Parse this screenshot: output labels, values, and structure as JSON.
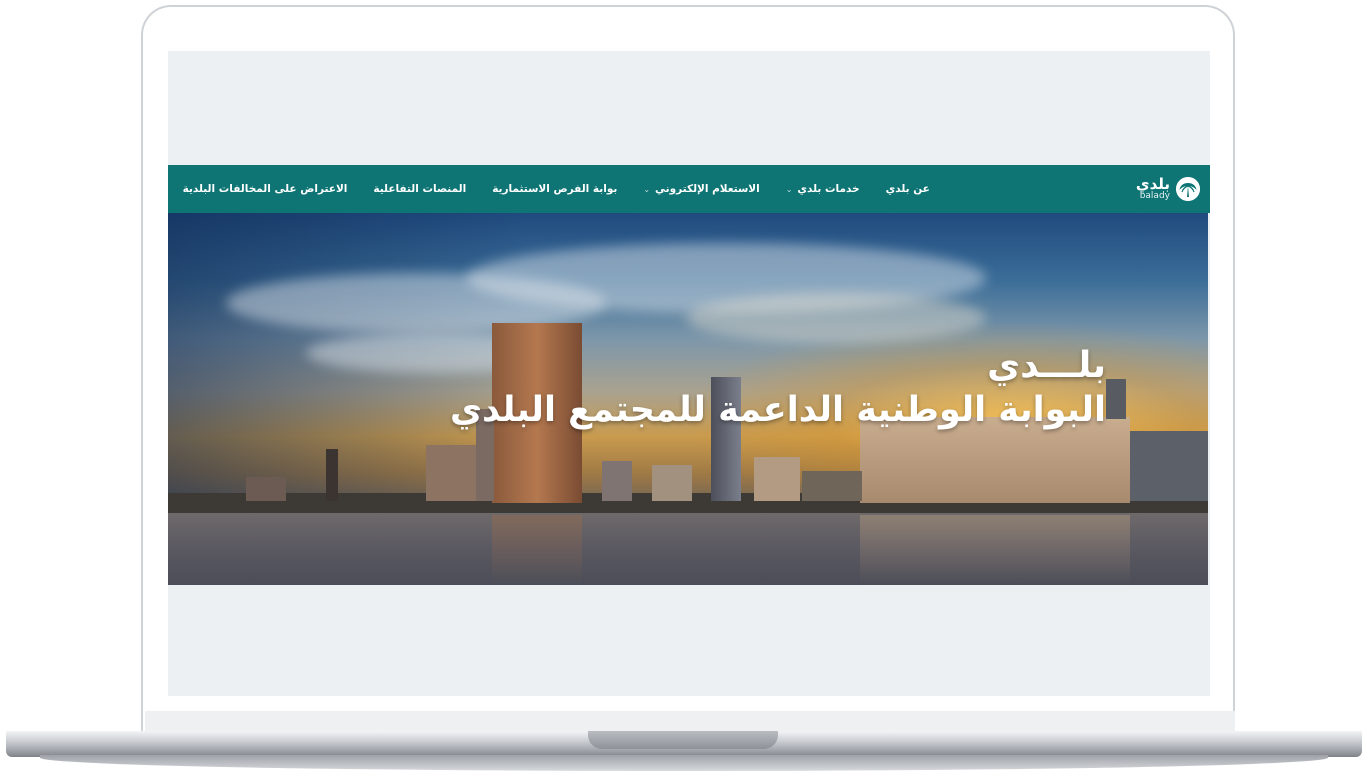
{
  "navbar": {
    "logo": {
      "ar": "بلدي",
      "en": "balady",
      "icon": "palm-emblem-icon"
    },
    "items": [
      {
        "label": "عن بلدي",
        "has_dropdown": false
      },
      {
        "label": "خدمات بلدي",
        "has_dropdown": true
      },
      {
        "label": "الاستعلام الإلكتروني",
        "has_dropdown": true
      },
      {
        "label": "بوابة الفرص الاستثمارية",
        "has_dropdown": false
      },
      {
        "label": "المنصات التفاعلية",
        "has_dropdown": false
      },
      {
        "label": "الاعتراض على المخالفات البلدية",
        "has_dropdown": false
      }
    ]
  },
  "hero": {
    "title": "بلـــدي",
    "subtitle": "البوابة الوطنية الداعمة للمجتمع البلدي"
  },
  "colors": {
    "navbar_bg": "#0e7474",
    "page_bg": "#edf0f2",
    "text_on_dark": "#ffffff"
  }
}
